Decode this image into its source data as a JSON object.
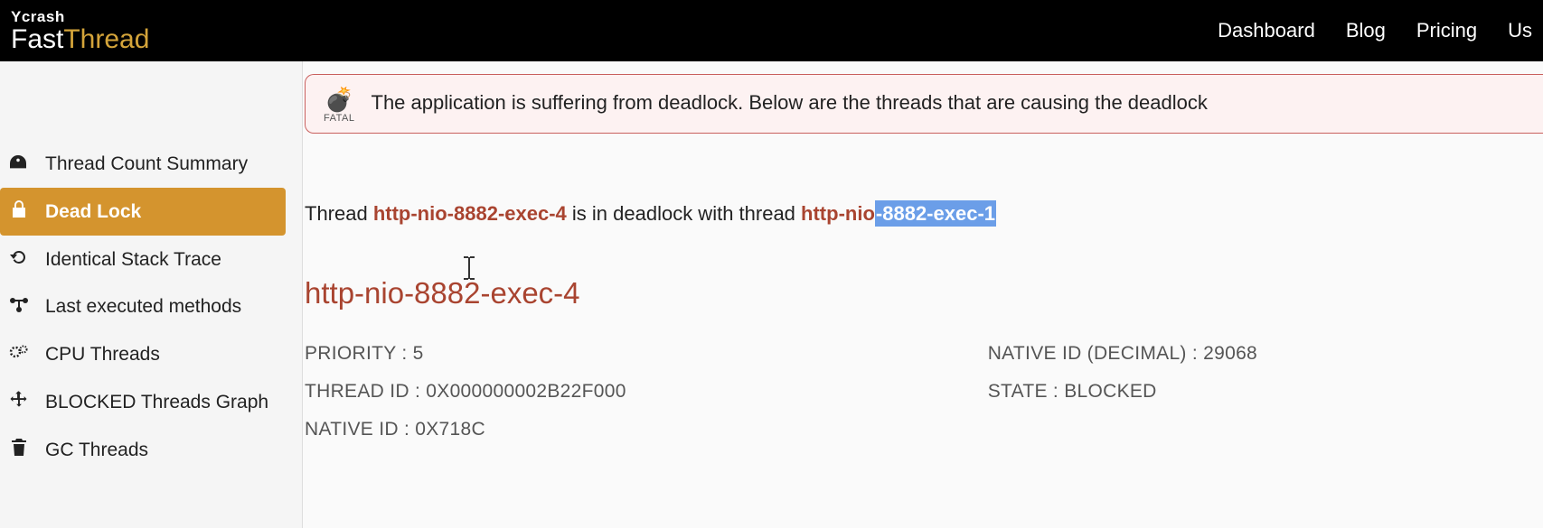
{
  "header": {
    "logo_top": "Ycrash",
    "logo_fast": "Fast",
    "logo_thread": "Thread",
    "nav": {
      "dashboard": "Dashboard",
      "blog": "Blog",
      "pricing": "Pricing",
      "us": "Us"
    }
  },
  "sidebar": {
    "items": [
      {
        "label": "Thread Count Summary",
        "icon": "dashboard-icon"
      },
      {
        "label": "Dead Lock",
        "icon": "lock-icon"
      },
      {
        "label": "Identical Stack Trace",
        "icon": "refresh-icon"
      },
      {
        "label": "Last executed methods",
        "icon": "flow-icon"
      },
      {
        "label": "CPU Threads",
        "icon": "gears-icon"
      },
      {
        "label": "BLOCKED Threads Graph",
        "icon": "move-icon"
      },
      {
        "label": "GC Threads",
        "icon": "trash-icon"
      }
    ]
  },
  "alert": {
    "fatal_label": "FATAL",
    "message": "The application is suffering from deadlock. Below are the threads that are causing the deadlock"
  },
  "deadlock_sentence": {
    "prefix": "Thread ",
    "thread_a": "http-nio-8882-exec-4",
    "middle": " is in deadlock with thread ",
    "thread_b_prefix": "http-nio",
    "thread_b_selected": "-8882-exec-1"
  },
  "thread_detail": {
    "title": "http-nio-8882-exec-4",
    "priority_label": "PRIORITY : ",
    "priority_value": "5",
    "thread_id_label": "THREAD ID : ",
    "thread_id_value": "0X000000002B22F000",
    "native_id_label": "NATIVE ID : ",
    "native_id_value": "0X718C",
    "native_id_dec_label": "NATIVE ID (DECIMAL) : ",
    "native_id_dec_value": "29068",
    "state_label": "STATE : ",
    "state_value": "BLOCKED"
  }
}
